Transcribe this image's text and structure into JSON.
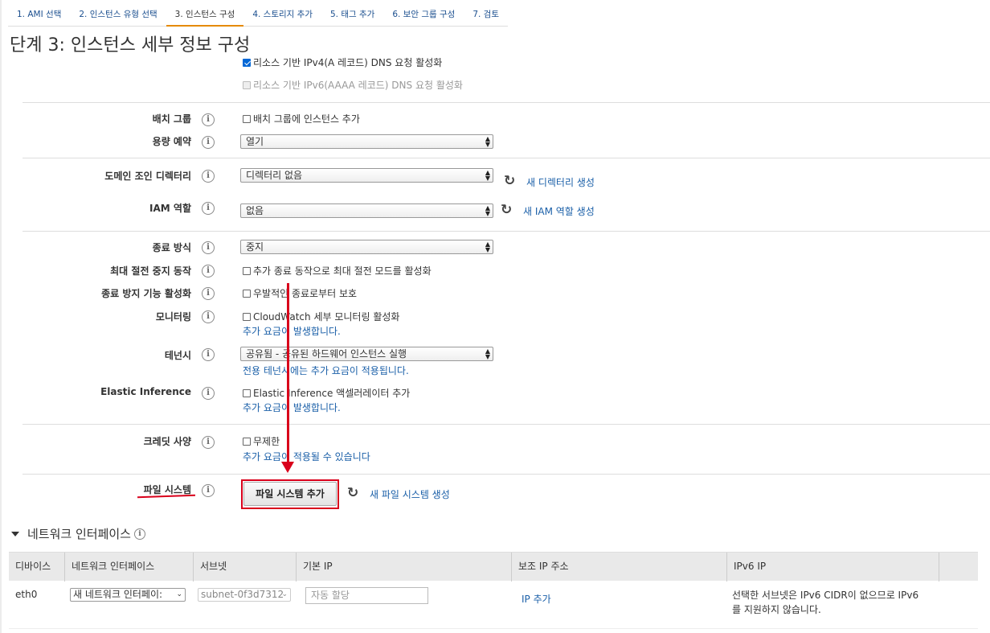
{
  "tabs": [
    {
      "label": "1. AMI 선택"
    },
    {
      "label": "2. 인스턴스 유형 선택"
    },
    {
      "label": "3. 인스턴스 구성"
    },
    {
      "label": "4. 스토리지 추가"
    },
    {
      "label": "5. 태그 추가"
    },
    {
      "label": "6. 보안 그룹 구성"
    },
    {
      "label": "7. 검토"
    }
  ],
  "page_title": "단계 3: 인스턴스 세부 정보 구성",
  "dns": {
    "ipv4_label": "리소스 기반 IPv4(A 레코드) DNS 요청 활성화",
    "ipv6_label": "리소스 기반 IPv6(AAAA 레코드) DNS 요청 활성화"
  },
  "info_glyph": "i",
  "placement_group": {
    "label": "배치 그룹",
    "checkbox": "배치 그룹에 인스턴스 추가"
  },
  "capacity_reservation": {
    "label": "용량 예약",
    "value": "열기"
  },
  "domain_join": {
    "label": "도메인 조인 디렉터리",
    "value": "디렉터리 없음",
    "link": "새 디렉터리 생성"
  },
  "iam_role": {
    "label": "IAM 역할",
    "value": "없음",
    "link": "새 IAM 역할 생성"
  },
  "shutdown_behavior": {
    "label": "종료 방식",
    "value": "중지"
  },
  "stop_hibernate": {
    "label": "최대 절전 중지 동작",
    "checkbox": "추가 종료 동작으로 최대 절전 모드를 활성화"
  },
  "termination_protection": {
    "label": "종료 방지 기능 활성화",
    "checkbox": "우발적인 종료로부터 보호"
  },
  "monitoring": {
    "label": "모니터링",
    "checkbox": "CloudWatch 세부 모니터링 활성화",
    "note": "추가 요금이 발생합니다."
  },
  "tenancy": {
    "label": "테넌시",
    "value": "공유됨 - 공유된 하드웨어 인스턴스 실행",
    "note": "전용 테넌시에는 추가 요금이 적용됩니다."
  },
  "elastic_inference": {
    "label": "Elastic Inference",
    "checkbox": "Elastic Inference 액셀러레이터 추가",
    "note": "추가 요금이 발생합니다."
  },
  "credit_spec": {
    "label": "크레딧 사양",
    "checkbox": "무제한",
    "note": "추가 요금이 적용될 수 있습니다"
  },
  "file_systems": {
    "label": "파일 시스템",
    "button": "파일 시스템 추가",
    "link": "새 파일 시스템 생성"
  },
  "network_interfaces": {
    "title": "네트워크 인터페이스",
    "columns": [
      "디바이스",
      "네트워크 인터페이스",
      "서브넷",
      "기본 IP",
      "보조 IP 주소",
      "IPv6 IP"
    ],
    "row": {
      "device": "eth0",
      "interface": "새 네트워크 인터페이:",
      "subnet": "subnet-0f3d7312",
      "primary_ip_placeholder": "자동 할당",
      "secondary_ip_link": "IP 추가",
      "ipv6_note_line1": "선택한 서브넷은 IPv6 CIDR이 없으므로 IPv6",
      "ipv6_note_line2": "를 지원하지 않습니다."
    }
  },
  "colors": {
    "accent": "#e58a00",
    "link": "#1a5fa8",
    "highlight": "#d9001b",
    "checkbox": "#0067d6"
  }
}
